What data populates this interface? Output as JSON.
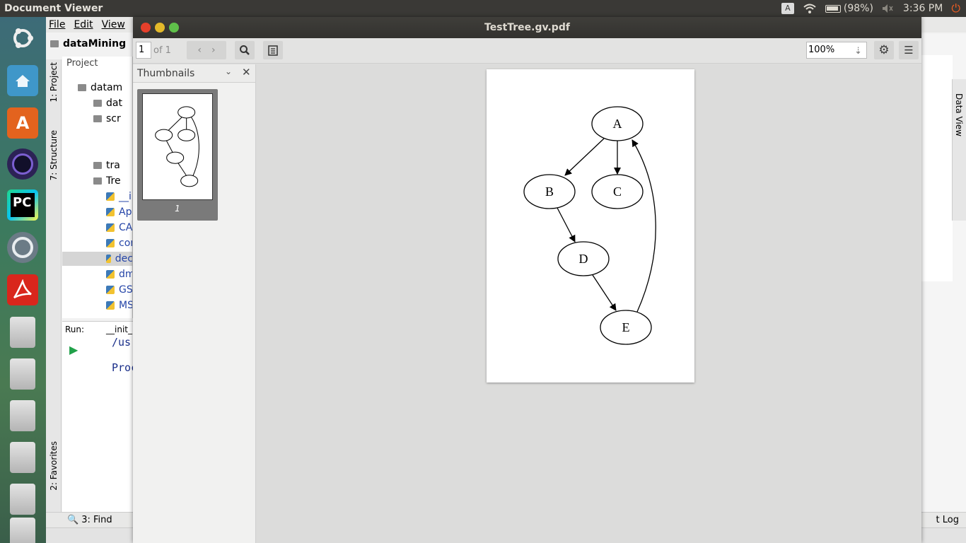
{
  "top_panel": {
    "app_title": "Document Viewer",
    "keyboard": "A",
    "battery": "(98%)",
    "time": "3:36 PM",
    "icons": [
      "wifi-icon",
      "battery-icon",
      "volume-icon",
      "power-icon"
    ]
  },
  "launcher": {
    "items": [
      "ubuntu-dash",
      "files",
      "software-center",
      "eclipse",
      "pycharm",
      "chromium",
      "acrobat-reader",
      "drive",
      "drive",
      "drive",
      "drive",
      "drive",
      "drive"
    ],
    "pycharm_label": "PC"
  },
  "ide": {
    "menu": [
      "File",
      "Edit",
      "View"
    ],
    "breadcrumb": "dataMining",
    "project_tab": "Project",
    "side_tabs": {
      "project": "1: Project",
      "structure": "7: Structure",
      "favorites": "2: Favorites"
    },
    "right_tab": "Data View",
    "tree": [
      "datam",
      "dat",
      "scr",
      "tra",
      "Tre",
      "__i",
      "Ap",
      "CA",
      "cor",
      "dec",
      "dm",
      "GS",
      "MS"
    ],
    "run_label": "Run:",
    "run_tab": "__init_",
    "console_lines": [
      "/us",
      "Proc"
    ],
    "bottom_tabs": {
      "find": "3: Find",
      "event_log": "t Log"
    }
  },
  "viewer": {
    "title": "TestTree.gv.pdf",
    "page_current": "1",
    "page_of": "of 1",
    "zoom": "100%",
    "sidebar_title": "Thumbnails",
    "thumb_page_number": "1",
    "graph": {
      "nodes": [
        "A",
        "B",
        "C",
        "D",
        "E"
      ],
      "edges": [
        [
          "A",
          "B"
        ],
        [
          "A",
          "C"
        ],
        [
          "B",
          "D"
        ],
        [
          "D",
          "E"
        ],
        [
          "E",
          "A"
        ]
      ]
    }
  }
}
